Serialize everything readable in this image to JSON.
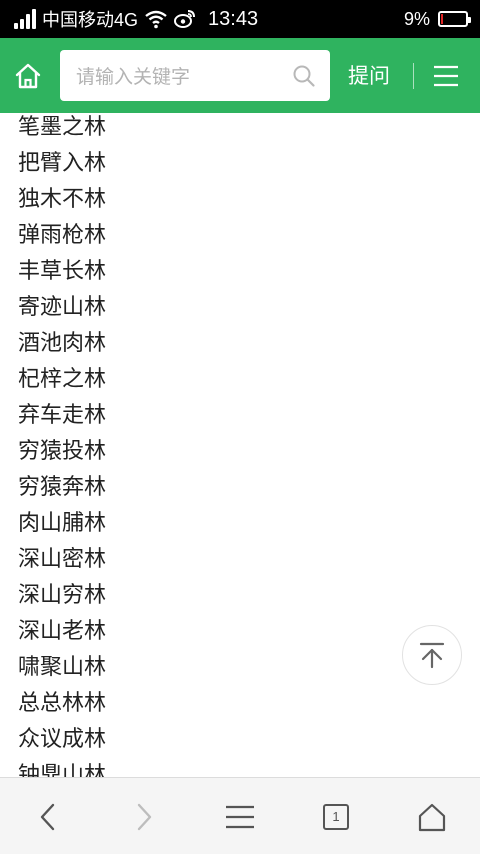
{
  "status_bar": {
    "carrier": "中国移动4G",
    "time": "13:43",
    "battery_text": "9%",
    "battery_level": 0.09
  },
  "header": {
    "search_placeholder": "请输入关键字",
    "ask_label": "提问",
    "color": "#2fb35f"
  },
  "idioms": [
    "笔墨之林",
    "把臂入林",
    "独木不林",
    "弹雨枪林",
    "丰草长林",
    "寄迹山林",
    "酒池肉林",
    "杞梓之林",
    "弃车走林",
    "穷猿投林",
    "穷猿奔林",
    "肉山脯林",
    "深山密林",
    "深山穷林",
    "深山老林",
    "啸聚山林",
    "总总林林",
    "众议成林",
    "钟鼎山林"
  ],
  "toolbar": {
    "tab_count": "1"
  }
}
